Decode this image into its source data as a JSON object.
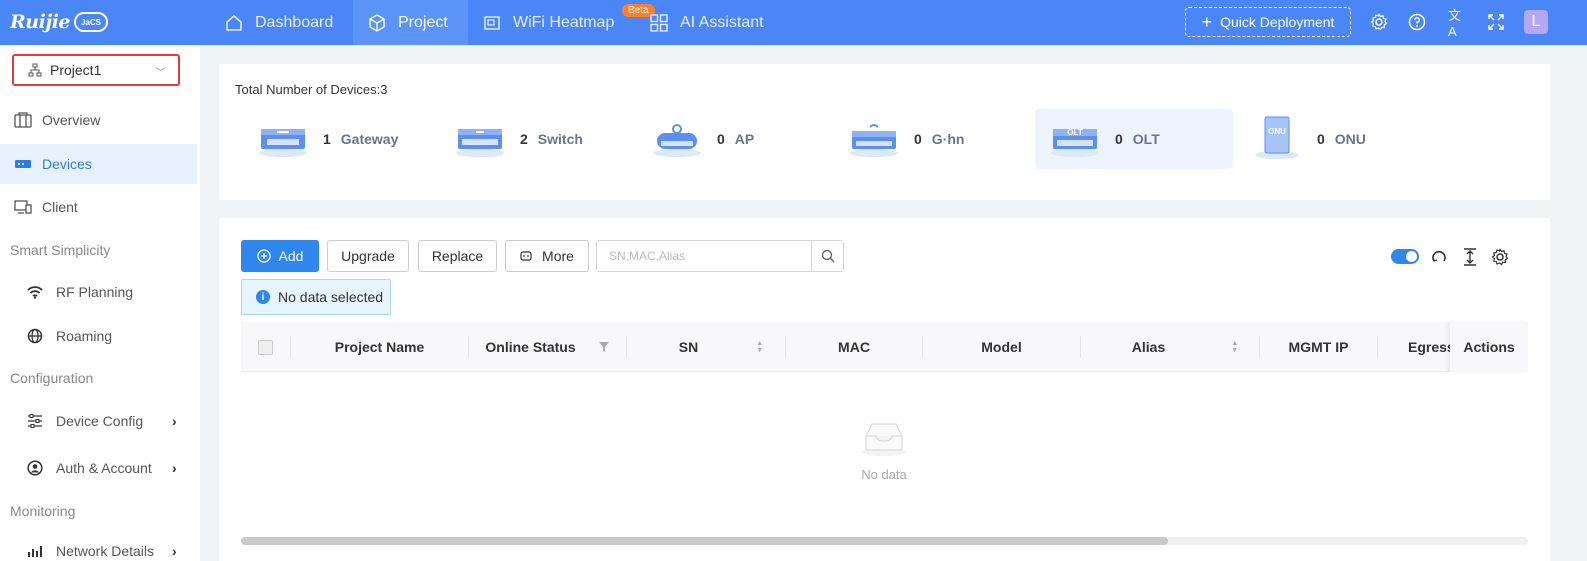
{
  "topbar": {
    "logo_text": "Ruijie",
    "logo_badge": "JaCS",
    "tabs": [
      {
        "label": "Dashboard",
        "icon": "home-icon"
      },
      {
        "label": "Project",
        "icon": "box-icon"
      },
      {
        "label": "WiFi Heatmap",
        "icon": "heatmap-icon"
      },
      {
        "label": "AI Assistant",
        "icon": "grid-icon"
      }
    ],
    "active_tab": "Project",
    "beta_badge": "Beta",
    "quick_deployment": "Quick Deployment",
    "avatar_letter": "L",
    "accent_color": "#4a86f6"
  },
  "sidebar": {
    "project_select": "Project1",
    "items": [
      {
        "label": "Overview",
        "icon": "overview-icon"
      },
      {
        "label": "Devices",
        "icon": "devices-icon"
      },
      {
        "label": "Client",
        "icon": "client-icon"
      }
    ],
    "section_smart": "Smart Simplicity",
    "smart_items": [
      {
        "label": "RF Planning",
        "icon": "wifi-icon"
      },
      {
        "label": "Roaming",
        "icon": "globe-icon"
      }
    ],
    "section_config": "Configuration",
    "config_items": [
      {
        "label": "Device Config",
        "icon": "sliders-icon"
      },
      {
        "label": "Auth & Account",
        "icon": "user-circle-icon"
      }
    ],
    "section_monitoring": "Monitoring",
    "monitoring_items": [
      {
        "label": "Network Details",
        "icon": "chart-icon"
      }
    ],
    "active_item": "Devices"
  },
  "summary": {
    "total_label": "Total Number of Devices:3",
    "devices": [
      {
        "count": "1",
        "name": "Gateway",
        "icon_text": ""
      },
      {
        "count": "2",
        "name": "Switch",
        "icon_text": ""
      },
      {
        "count": "0",
        "name": "AP",
        "icon_text": ""
      },
      {
        "count": "0",
        "name": "G·hn",
        "icon_text": ""
      },
      {
        "count": "0",
        "name": "OLT",
        "icon_text": "OLT"
      },
      {
        "count": "0",
        "name": "ONU",
        "icon_text": "ONU"
      }
    ]
  },
  "toolbar": {
    "add": "Add",
    "upgrade": "Upgrade",
    "replace": "Replace",
    "more": "More",
    "search_placeholder": "SN,MAC,Alias",
    "no_data_selected": "No data selected"
  },
  "table": {
    "columns": [
      "Project Name",
      "Online Status",
      "SN",
      "MAC",
      "Model",
      "Alias",
      "MGMT IP",
      "Egress",
      "Actions"
    ],
    "rows": [],
    "empty_text": "No data"
  }
}
